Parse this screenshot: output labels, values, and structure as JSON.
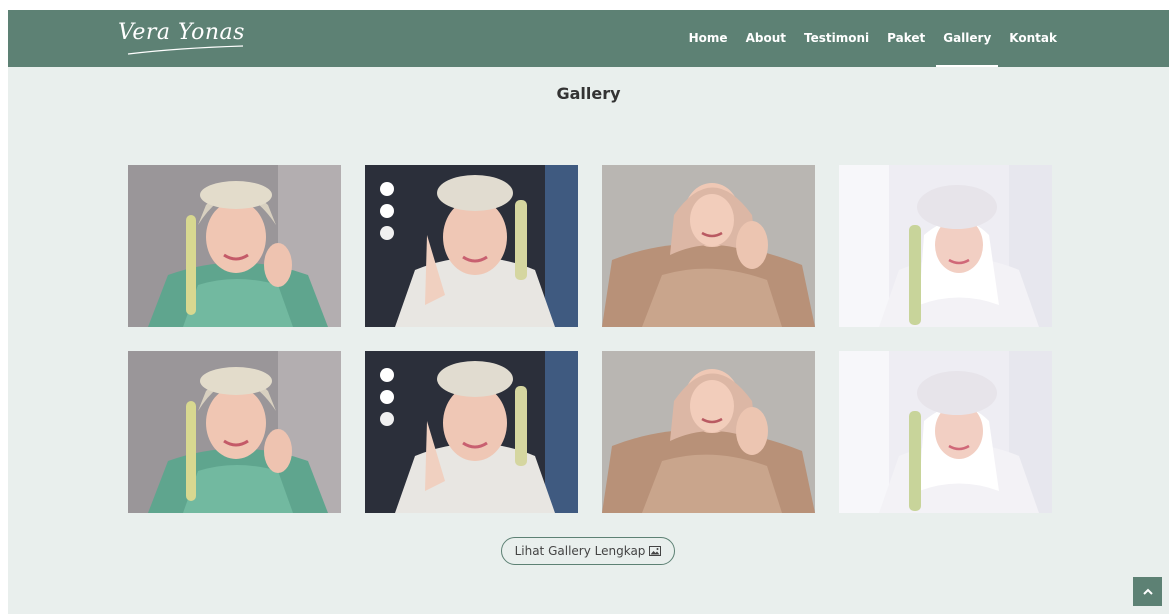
{
  "brand": {
    "logo_text": "Vera Yonas"
  },
  "nav": {
    "items": [
      {
        "label": "Home"
      },
      {
        "label": "About"
      },
      {
        "label": "Testimoni"
      },
      {
        "label": "Paket"
      },
      {
        "label": "Gallery"
      },
      {
        "label": "Kontak"
      }
    ],
    "active": "Gallery"
  },
  "gallery": {
    "title": "Gallery",
    "photos": [
      {
        "subject": "bride-green-kebaya"
      },
      {
        "subject": "bride-white-mirror-lights"
      },
      {
        "subject": "bride-gold-lace"
      },
      {
        "subject": "bride-white-veil"
      },
      {
        "subject": "bride-green-kebaya"
      },
      {
        "subject": "bride-white-mirror-lights"
      },
      {
        "subject": "bride-gold-lace"
      },
      {
        "subject": "bride-white-veil"
      }
    ],
    "button_label": "Lihat Gallery Lengkap"
  },
  "icons": {
    "button_icon": "image-icon",
    "scroll_top": "chevron-up-icon"
  },
  "colors": {
    "nav_bg": "#5d8174",
    "page_bg": "#e9efed",
    "accent": "#5d8174"
  }
}
